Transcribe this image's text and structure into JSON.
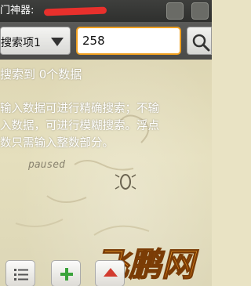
{
  "titlebar": {
    "title": "门神器: "
  },
  "search": {
    "type_selected": "搜索项1",
    "value": "258"
  },
  "result": {
    "text": "搜索到 0个数据"
  },
  "help": {
    "text": "输入数据可进行精确搜索；不输\n入数据，可进行模糊搜索。浮点\n数只需输入整数部分。"
  },
  "wallpaper": {
    "doodle_text": "paused"
  },
  "watermark": {
    "text": "飞鹏网"
  },
  "toolbar": {
    "buttons": [
      {
        "icon": "list-icon"
      },
      {
        "icon": "plus-icon",
        "color": "#3aa33a"
      },
      {
        "icon": "up-arrow-icon",
        "color": "#d23b2f"
      }
    ]
  },
  "colors": {
    "input_border": "#f0a020",
    "titlebar_bg": "#3a3b39",
    "search_row_bg": "#525250",
    "redaction": "#e8302c",
    "watermark_orange": "#f39a1b"
  }
}
